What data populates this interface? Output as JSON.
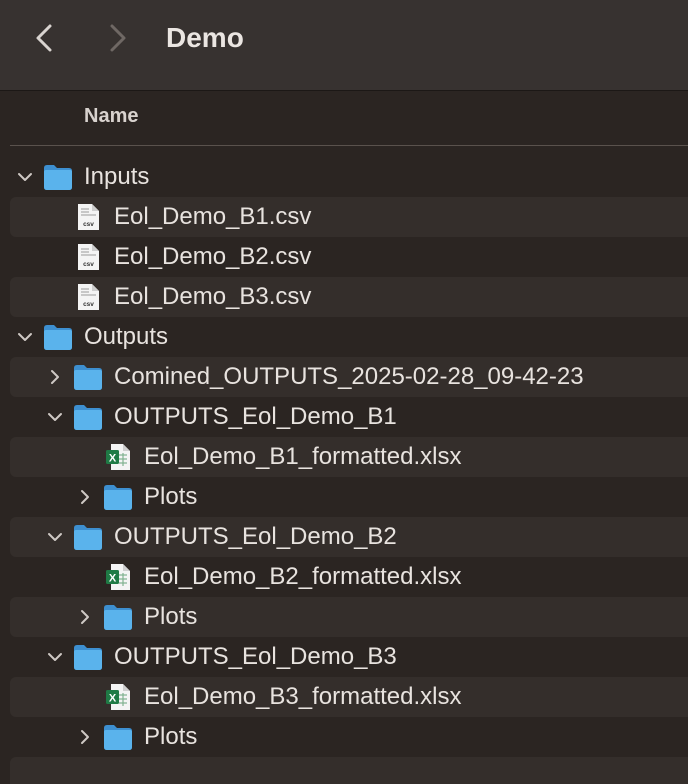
{
  "window": {
    "title": "Demo",
    "back_icon": "chevron-left-icon",
    "forward_icon": "chevron-right-icon"
  },
  "header": {
    "name_column": "Name"
  },
  "colors": {
    "titlebar": "#373230",
    "background": "#2b2522",
    "row_stripe": "#342e2b",
    "folder_blue": "#5ab3ec",
    "excel_green": "#1f7a45"
  },
  "items": [
    {
      "label": "Inputs",
      "kind": "folder",
      "level": 0,
      "expanded": true
    },
    {
      "label": "Eol_Demo_B1.csv",
      "kind": "csv",
      "level": 1
    },
    {
      "label": "Eol_Demo_B2.csv",
      "kind": "csv",
      "level": 1
    },
    {
      "label": "Eol_Demo_B3.csv",
      "kind": "csv",
      "level": 1
    },
    {
      "label": "Outputs",
      "kind": "folder",
      "level": 0,
      "expanded": true
    },
    {
      "label": "Comined_OUTPUTS_2025-02-28_09-42-23",
      "kind": "folder",
      "level": 1,
      "expanded": false
    },
    {
      "label": "OUTPUTS_Eol_Demo_B1",
      "kind": "folder",
      "level": 1,
      "expanded": true
    },
    {
      "label": "Eol_Demo_B1_formatted.xlsx",
      "kind": "xlsx",
      "level": 2
    },
    {
      "label": "Plots",
      "kind": "folder",
      "level": 2,
      "expanded": false
    },
    {
      "label": "OUTPUTS_Eol_Demo_B2",
      "kind": "folder",
      "level": 1,
      "expanded": true
    },
    {
      "label": "Eol_Demo_B2_formatted.xlsx",
      "kind": "xlsx",
      "level": 2
    },
    {
      "label": "Plots",
      "kind": "folder",
      "level": 2,
      "expanded": false
    },
    {
      "label": "OUTPUTS_Eol_Demo_B3",
      "kind": "folder",
      "level": 1,
      "expanded": true
    },
    {
      "label": "Eol_Demo_B3_formatted.xlsx",
      "kind": "xlsx",
      "level": 2
    },
    {
      "label": "Plots",
      "kind": "folder",
      "level": 2,
      "expanded": false
    }
  ],
  "icon_text": {
    "csv_badge": "csv",
    "xlsx_badge": "X"
  }
}
